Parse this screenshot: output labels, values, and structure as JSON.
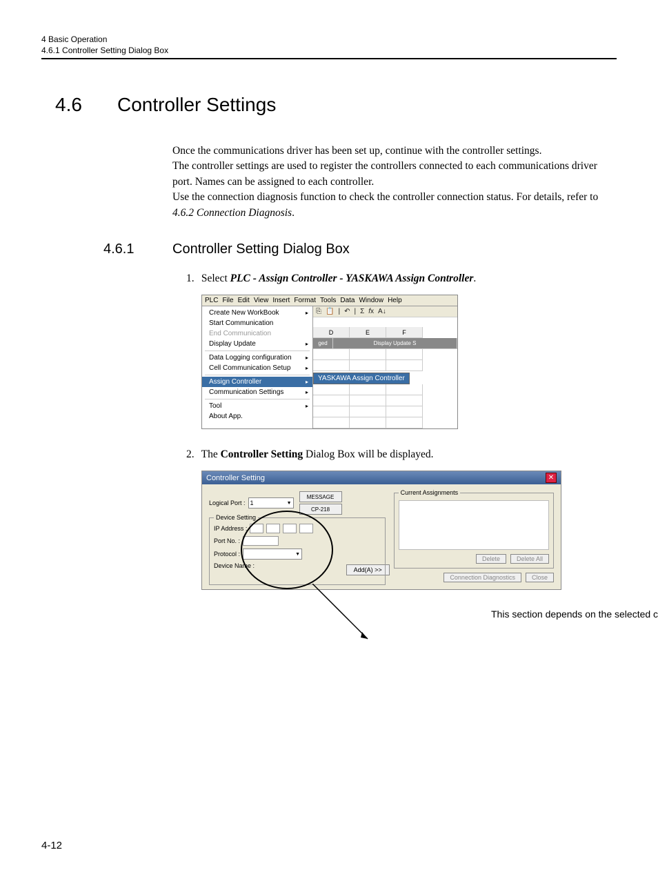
{
  "header": {
    "chapter": "4  Basic Operation",
    "section": "4.6.1  Controller Setting Dialog Box"
  },
  "h1": {
    "num": "4.6",
    "title": "Controller Settings"
  },
  "intro": {
    "p1": "Once the communications driver has been set up, continue with the controller settings.",
    "p2": "The controller settings are used to register the controllers connected to each communications driver port. Names can be assigned to each controller.",
    "p3a": "Use the connection diagnosis function to check the controller connection status. For details, refer to ",
    "p3ref": "4.6.2  Connection Diagnosis",
    "p3b": "."
  },
  "h2": {
    "num": "4.6.1",
    "title": "Controller Setting Dialog Box"
  },
  "steps": {
    "s1": {
      "n": "1.",
      "lead": "Select ",
      "bi": "PLC - Assign Controller - YASKAWA Assign Controller",
      "tail": "."
    },
    "s2": {
      "n": "2.",
      "lead": "The ",
      "b": "Controller Setting",
      "tail": " Dialog Box will be displayed."
    }
  },
  "fig1": {
    "menubar": [
      "PLC",
      "File",
      "Edit",
      "View",
      "Insert",
      "Format",
      "Tools",
      "Data",
      "Window",
      "Help"
    ],
    "menu": {
      "i0": "Create New WorkBook",
      "i1": "Start Communication",
      "i2": "End Communication",
      "i3": "Display Update",
      "i4": "Data Logging configuration",
      "i5": "Cell Communication Setup",
      "i6": "Assign Controller",
      "i7": "Communication Settings",
      "i8": "Tool",
      "i9": "About App."
    },
    "submenu": "YASKAWA Assign Controller",
    "col_D": "D",
    "col_E": "E",
    "col_F": "F",
    "cellA": "ged",
    "cellB": "Display Update S"
  },
  "fig2": {
    "title": "Controller Setting",
    "logical_port_lbl": "Logical Port :",
    "logical_port_val": "1",
    "tab_message": "MESSAGE",
    "tab_cp218": "CP-218",
    "group_device": "Device Setting",
    "ip_lbl": "IP Address :",
    "portno_lbl": "Port No. :",
    "protocol_lbl": "Protocol :",
    "devicename_lbl": "Device Name :",
    "add_btn": "Add(A) >>",
    "group_current": "Current Assignments",
    "delete_btn": "Delete",
    "delete_all_btn": "Delete All",
    "conn_diag_btn": "Connection Diagnostics",
    "close_btn": "Close"
  },
  "callout": "This section depends on the selected communications",
  "pagenum": "4-12"
}
